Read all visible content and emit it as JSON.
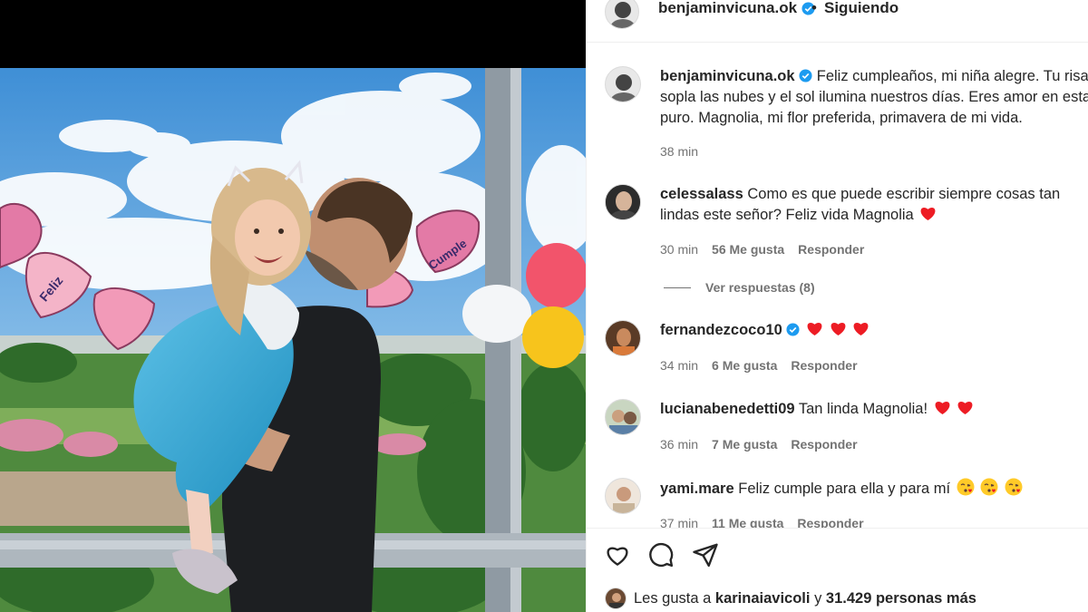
{
  "post_author": {
    "username": "benjaminvicuna.ok",
    "separator": "•",
    "follow_status": "Siguiendo"
  },
  "caption": {
    "username": "benjaminvicuna.ok",
    "lines": [
      "Feliz cumpleaños, mi niña alegre. Tu risa",
      "sopla las nubes y el sol ilumina nuestros días. Eres amor en estado",
      "puro. Magnolia, mi flor preferida, primavera de mi vida."
    ],
    "time": "38 min"
  },
  "photo": {
    "decorations": {
      "banner_feliz": "Feliz",
      "banner_cumple": "Cumple"
    }
  },
  "comments": [
    {
      "username": "celessalass",
      "lines": [
        "Como es que puede escribir siempre cosas tan",
        "lindas este señor? Feliz vida Magnolia"
      ],
      "emojis": [
        "heart"
      ],
      "time": "30 min",
      "likes": "56 Me gusta",
      "reply": "Responder"
    },
    {
      "username": "fernandezcoco10",
      "verified": true,
      "lines": [
        ""
      ],
      "emojis": [
        "heart",
        "heart",
        "heart"
      ],
      "time": "34 min",
      "likes": "6 Me gusta",
      "reply": "Responder"
    },
    {
      "username": "lucianabenedetti09",
      "lines": [
        "Tan linda Magnolia!"
      ],
      "emojis": [
        "heart",
        "heart"
      ],
      "time": "36 min",
      "likes": "7 Me gusta",
      "reply": "Responder"
    },
    {
      "username": "yami.mare",
      "lines": [
        "Feliz cumple para ella y para mí"
      ],
      "emojis": [
        "kiss-face",
        "kiss-face",
        "kiss-face"
      ],
      "time": "37 min",
      "likes": "11 Me gusta",
      "reply": "Responder"
    }
  ],
  "view_replies": "Ver respuestas (8)",
  "actions": {
    "like_icon": "heart-outline-icon",
    "comment_icon": "comment-icon",
    "share_icon": "share-icon"
  },
  "likes_summary": {
    "prefix": "Les gusta a",
    "user": "karinaiavicoli",
    "conjunction": "y",
    "count": "31.429 personas más"
  },
  "colors": {
    "heart": "#ed1c24",
    "verified": "#1d9bf0",
    "meta_gray": "#737373"
  }
}
